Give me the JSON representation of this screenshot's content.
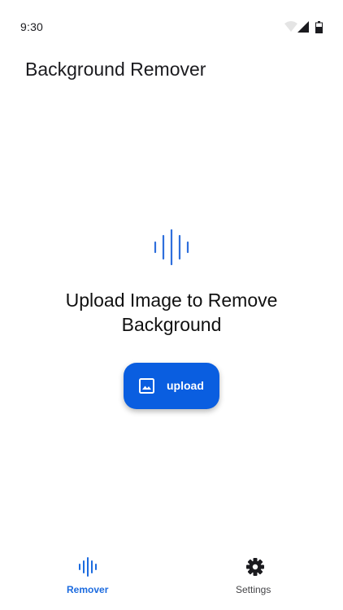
{
  "status_bar": {
    "time": "9:30",
    "icons": [
      "wifi-icon",
      "cellular-signal-icon",
      "battery-icon"
    ]
  },
  "app": {
    "title": "Background Remover"
  },
  "main": {
    "hero_icon": "sound-wave-icon",
    "message": "Upload Image to Remove Background",
    "upload_button": {
      "icon": "image-icon",
      "label": "upload"
    }
  },
  "bottom_nav": {
    "items": [
      {
        "label": "Remover",
        "icon": "sound-wave-icon",
        "active": true
      },
      {
        "label": "Settings",
        "icon": "gear-icon",
        "active": false
      }
    ]
  },
  "colors": {
    "accent": "#1c6bdf",
    "button": "#0a5ee0",
    "text": "#1b1b1f"
  }
}
